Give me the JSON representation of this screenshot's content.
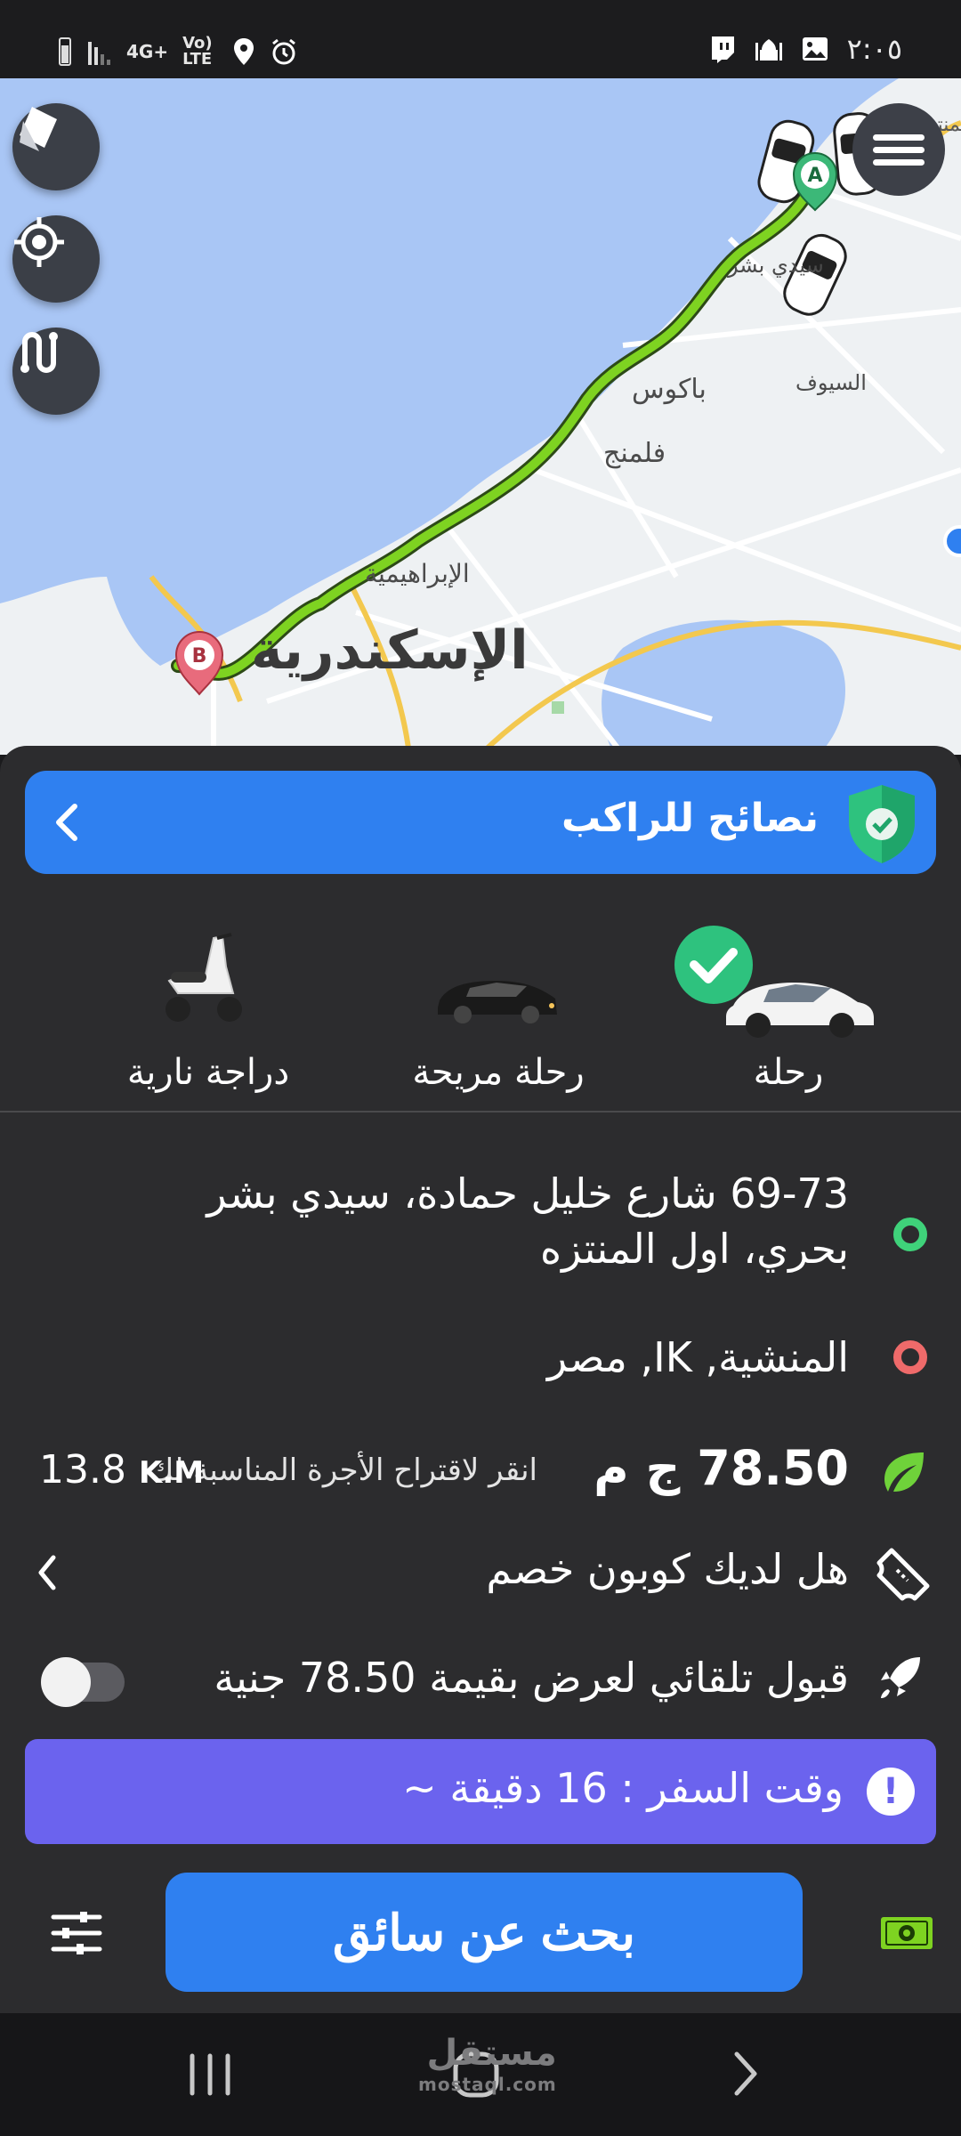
{
  "status_bar": {
    "time": "٢:٠٥",
    "network": "4G+",
    "volte": "Vo) LTE"
  },
  "map": {
    "labels": {
      "sidi_bishr": "سيدي بشر",
      "bakos": "باكوس",
      "siouf": "السيوف",
      "fleming": "فلمنج",
      "ibrahimia": "الإبراهيمية",
      "alexandria": "الإسكندرية",
      "top_right_partial": "المنتزة"
    },
    "marker_a": "A",
    "marker_b": "B",
    "route_color": "#7ed321"
  },
  "tips_banner": {
    "title": "نصائح للراكب",
    "accent": "#2f80f0"
  },
  "ride_types": [
    {
      "label": "رحلة",
      "selected": true
    },
    {
      "label": "رحلة مريحة",
      "selected": false
    },
    {
      "label": "دراجة نارية",
      "selected": false
    }
  ],
  "pickup": {
    "line1": "69-73 شارع خليل حمادة، سيدي بشر",
    "line2": "بحري، اول المنتزه"
  },
  "dropoff": {
    "address": "المنشية, IK, مصر"
  },
  "fare": {
    "price": "78.50 ج م",
    "hint": "انقر لاقتراح الأجرة المناسبة لك",
    "distance_value": "13.8",
    "distance_unit": "K.M"
  },
  "coupon": {
    "text": "هل لديك كوبون خصم"
  },
  "auto_accept": {
    "text": "قبول تلقائي لعرض بقيمة 78.50 جنية",
    "enabled": false
  },
  "travel_notice": {
    "text": "وقت السفر : 16 دقيقة ~",
    "accent": "#6b63ee"
  },
  "search_button": {
    "label": "بحث عن سائق"
  },
  "watermark": {
    "brand": "مستقل",
    "domain": "mostaql.com"
  }
}
